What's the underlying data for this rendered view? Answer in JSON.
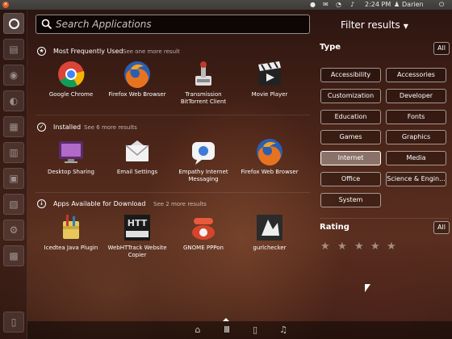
{
  "top_panel": {
    "time": "2:24 PM",
    "user": "Darien",
    "icons": [
      "app-indicator-icon",
      "mail-icon",
      "network-icon",
      "sound-icon",
      "power-icon"
    ]
  },
  "search": {
    "placeholder": "Search Applications",
    "value": ""
  },
  "sections": [
    {
      "title": "Most Frequently Used",
      "more": "See one more result",
      "icon": "star-icon",
      "apps": [
        {
          "name": "Google Chrome",
          "icon": "chrome-icon"
        },
        {
          "name": "Firefox Web Browser",
          "icon": "firefox-icon"
        },
        {
          "name": "Transmission BitTorrent Client",
          "icon": "transmission-icon"
        },
        {
          "name": "Movie Player",
          "icon": "movie-player-icon"
        }
      ]
    },
    {
      "title": "Installed",
      "more": "See 6 more results",
      "icon": "check-icon",
      "apps": [
        {
          "name": "Desktop Sharing",
          "icon": "desktop-sharing-icon"
        },
        {
          "name": "Email Settings",
          "icon": "email-settings-icon"
        },
        {
          "name": "Empathy Internet Messaging",
          "icon": "empathy-icon"
        },
        {
          "name": "Firefox Web Browser",
          "icon": "firefox-icon"
        }
      ]
    },
    {
      "title": "Apps Available for Download",
      "more": "See 2 more results",
      "icon": "download-icon",
      "apps": [
        {
          "name": "Icedtea Java Plugin",
          "icon": "icedtea-icon"
        },
        {
          "name": "WebHTTrack Website Copier",
          "icon": "webhttrack-icon"
        },
        {
          "name": "GNOME PPPon",
          "icon": "phone-icon"
        },
        {
          "name": "gurlchecker",
          "icon": "gurlchecker-icon"
        }
      ]
    }
  ],
  "filters": {
    "title": "Filter results",
    "type_label": "Type",
    "all_label": "All",
    "categories": [
      "Accessibility",
      "Accessories",
      "Customization",
      "Developer",
      "Education",
      "Fonts",
      "Games",
      "Graphics",
      "Internet",
      "Media",
      "Office",
      "Science & Engin...",
      "System"
    ],
    "active_category": "Internet",
    "rating_label": "Rating",
    "rating_all_label": "All",
    "rating_stars": 5
  },
  "lenses": [
    "home-icon",
    "applications-icon",
    "files-icon",
    "music-icon"
  ],
  "active_lens": "applications-icon",
  "colors": {
    "panel": "#3c3b37",
    "active_filter": "#ffffff",
    "close_button": "#e05a2a"
  }
}
